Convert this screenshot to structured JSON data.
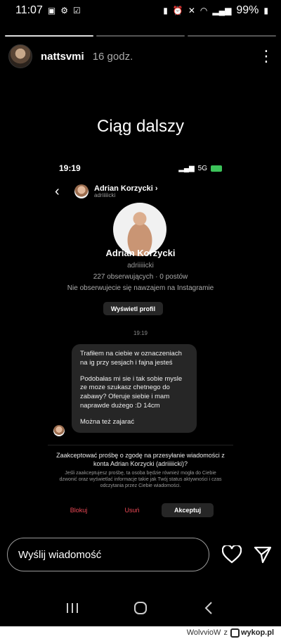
{
  "status_bar": {
    "time": "11:07",
    "battery": "99%"
  },
  "story": {
    "username": "nattsvmi",
    "time_ago": "16 godz.",
    "caption": "Ciąg dalszy",
    "progress": {
      "segments": 3,
      "completed": 1
    }
  },
  "screenshot": {
    "time": "19:19",
    "network": "5G",
    "contact_name": "Adrian Korzycki",
    "contact_handle": "adriiiiicki",
    "profile_name": "Adrian Korzycki",
    "profile_handle": "adriiiiicki",
    "profile_stats": "227 obserwujących · 0 postów",
    "profile_note": "Nie obserwujecie się nawzajem na Instagramie",
    "view_profile_label": "Wyświetl profil",
    "message_time": "19:19",
    "messages": [
      "Trafiłem na ciebie w oznaczeniach na ig przy sesjach i fajna jesteś",
      "Podobałas mi sie i tak sobie mysle ze moze szukasz chetnego do zabawy? Oferuje siebie i mam naprawde dużego :D 14cm",
      "Można też zajarać"
    ],
    "request_title": "Zaakceptować prośbę o zgodę na przesyłanie wiadomości z konta Adrian Korzycki (adriiiiicki)?",
    "request_desc": "Jeśli zaakceptujesz prośbę, ta osoba będzie również mogła do Ciebie dzwonić oraz wyświetlać informacje takie jak Twój status aktywności i czas odczytania przez Ciebie wiadomości.",
    "block_label": "Blokuj",
    "delete_label": "Usuń",
    "accept_label": "Akceptuj"
  },
  "reply": {
    "placeholder": "Wyślij wiadomość"
  },
  "footer": {
    "author": "WolvvioW",
    "separator": "z",
    "site": "wykop.pl"
  }
}
